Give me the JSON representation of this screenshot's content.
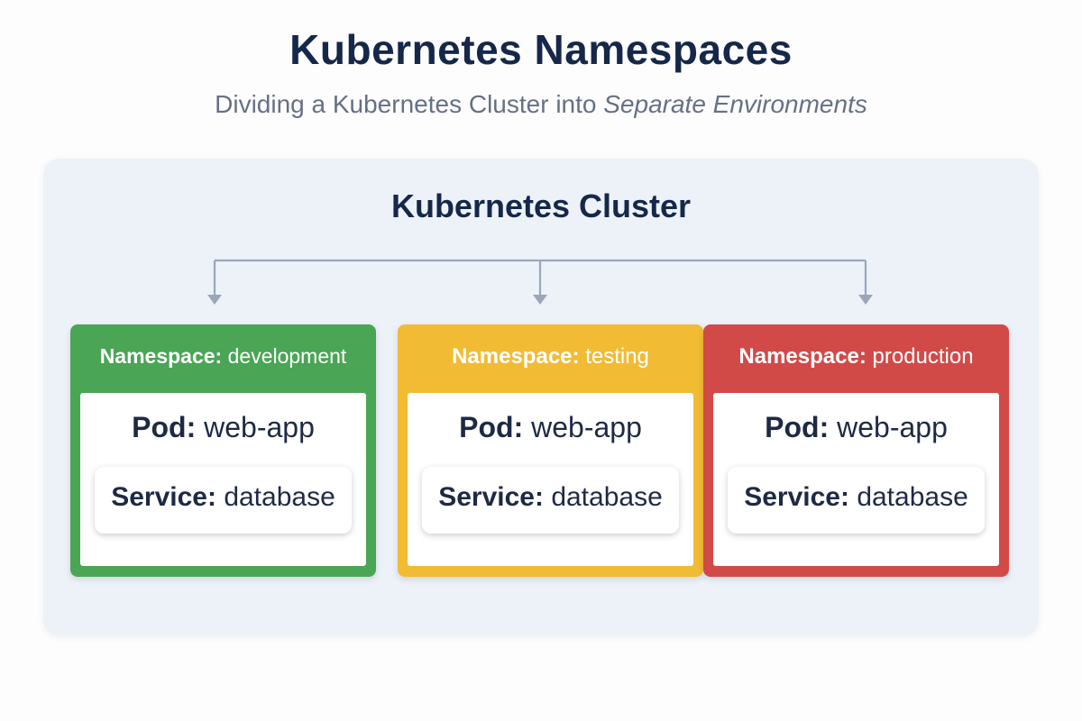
{
  "title": "Kubernetes Namespaces",
  "subtitle": {
    "plain": "Dividing a Kubernetes Cluster into ",
    "emphasis": "Separate Environments"
  },
  "cluster": {
    "title": "Kubernetes Cluster",
    "connector_color": "#9aa7b8",
    "namespaces": [
      {
        "key": "Namespace:",
        "name": "development",
        "color": "#4aa555",
        "pod_key": "Pod:",
        "pod_name": "web-app",
        "service_key": "Service:",
        "service_name": "database"
      },
      {
        "key": "Namespace:",
        "name": "testing",
        "color": "#f2bb34",
        "pod_key": "Pod:",
        "pod_name": "web-app",
        "service_key": "Service:",
        "service_name": "database"
      },
      {
        "key": "Namespace:",
        "name": "production",
        "color": "#d24a48",
        "pod_key": "Pod:",
        "pod_name": "web-app",
        "service_key": "Service:",
        "service_name": "database"
      }
    ]
  }
}
